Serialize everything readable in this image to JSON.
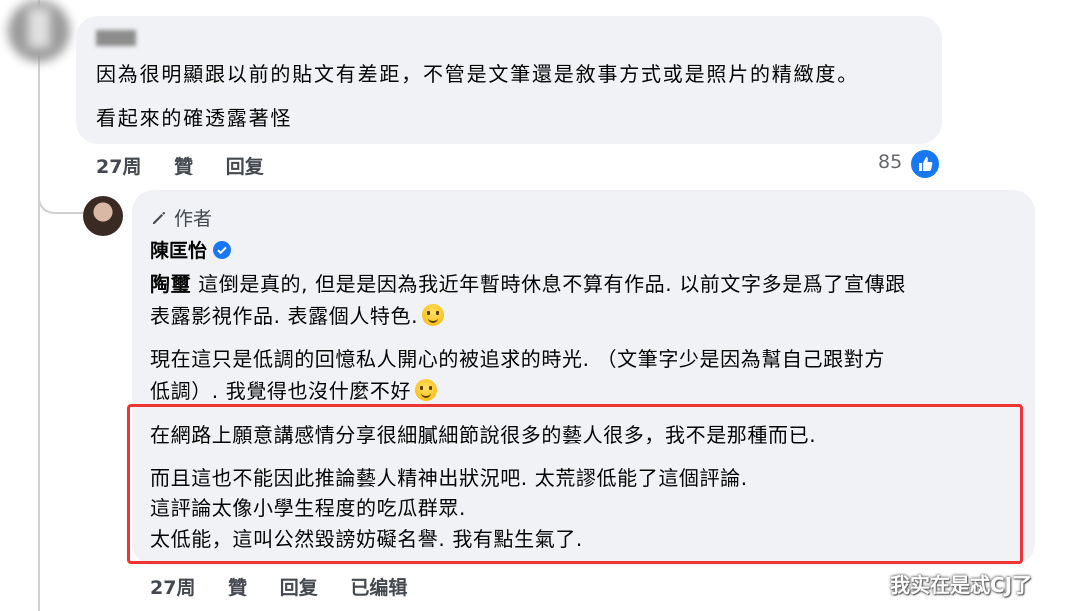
{
  "comment1": {
    "line1": "因為很明顯跟以前的貼文有差距，不管是文筆還是敘事方式或是照片的精緻度。",
    "line2": "看起來的確透露著怪",
    "time": "27周",
    "like": "贊",
    "reply": "回复",
    "reaction_count": "85"
  },
  "reply": {
    "author_badge": "作者",
    "author_name": "陳匡怡",
    "mention": "陶璽",
    "p1_line1": " 這倒是真的, 但是是因為我近年暫時休息不算有作品. 以前文字多是爲了宣傳跟",
    "p1_line2": "表露影視作品. 表露個人特色.",
    "p2_line1": "現在這只是低調的回憶私人開心的被追求的時光. （文筆字少是因為幫自己跟對方",
    "p2_line2": "低調）. 我覺得也沒什麼不好",
    "p3_line1": "在網路上願意講感情分享很細膩細節說很多的藝人很多，我不是那種而已.",
    "p4_line1": "而且這也不能因此推論藝人精神出狀況吧. 太荒謬低能了這個評論.",
    "p4_line2": "這評論太像小學生程度的吃瓜群眾.",
    "p4_line3": "太低能，這叫公然毀謗妨礙名譽. 我有點生氣了.",
    "time": "27周",
    "like": "贊",
    "reply": "回复",
    "edited": "已编辑"
  },
  "watermark": "我实在是忒CJ了",
  "colors": {
    "bubble": "#f0f2f5",
    "highlight_box": "#ee3535",
    "like_blue": "#1877f2"
  },
  "icons": {
    "author_badge": "pencil-icon",
    "verified": "verified-badge-icon",
    "reaction": "thumbs-up-icon",
    "emoji": "smiling-face-emoji"
  }
}
